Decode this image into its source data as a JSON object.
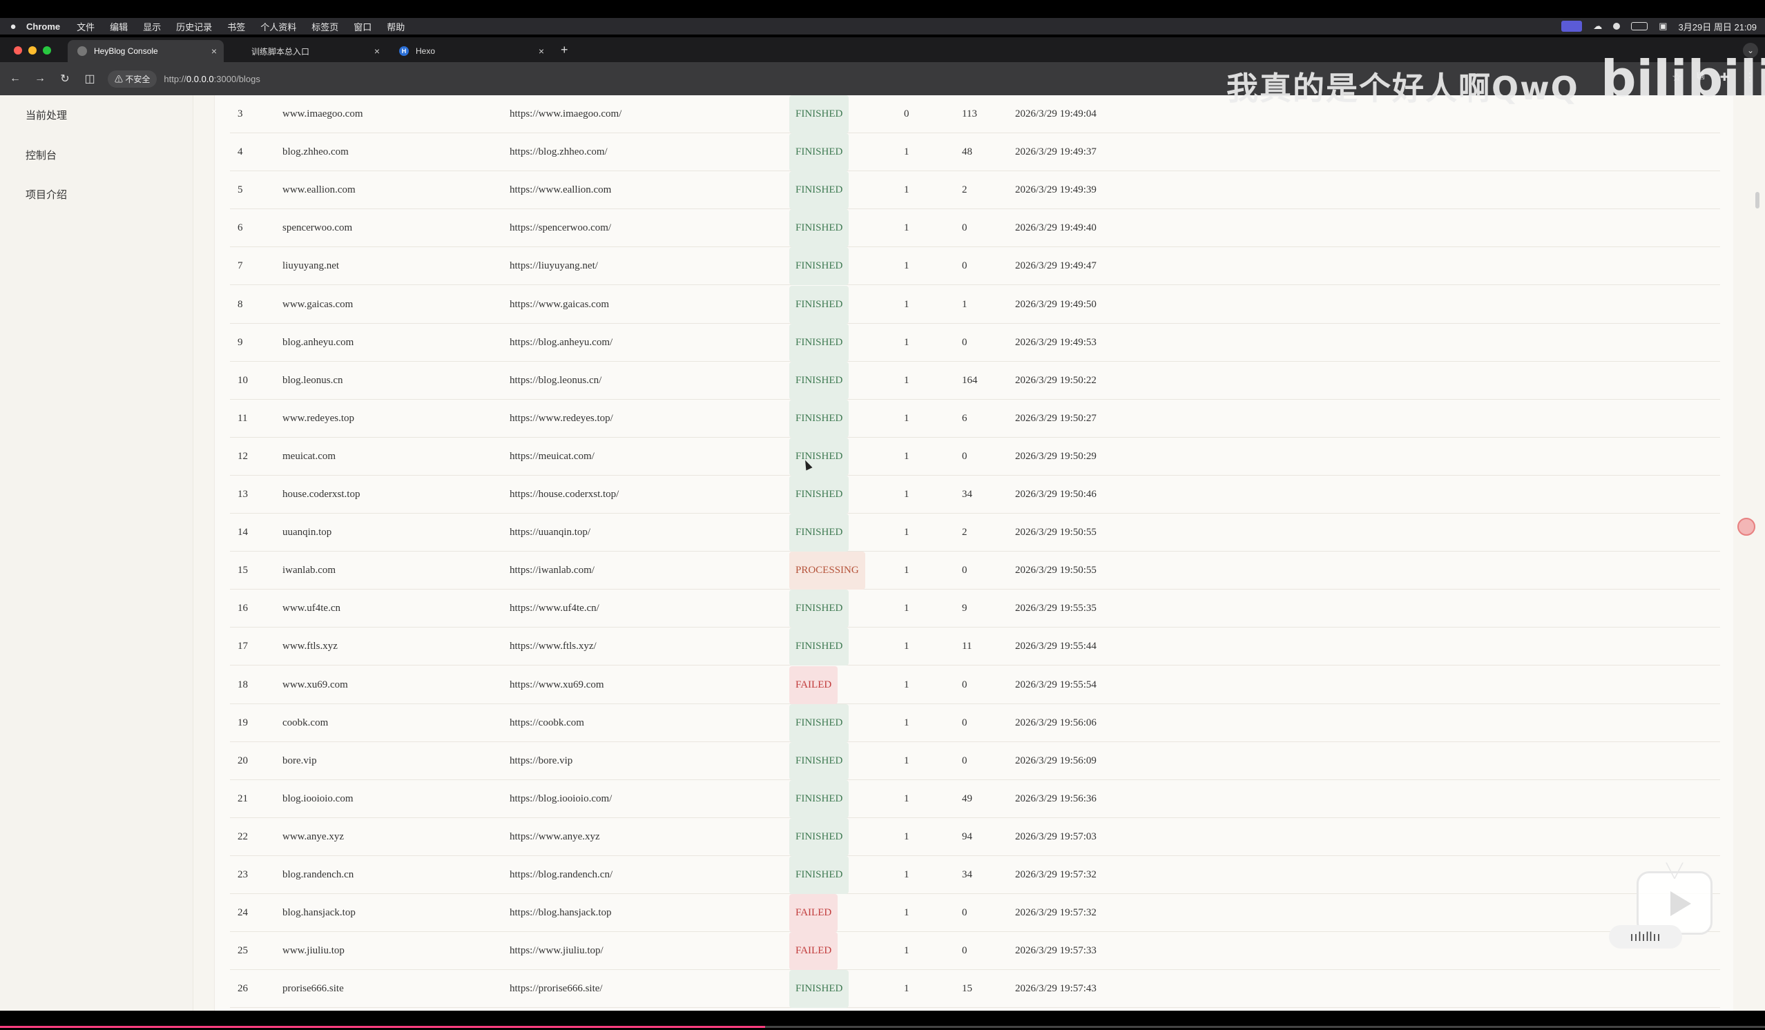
{
  "menubar": {
    "app": "Chrome",
    "items": [
      "文件",
      "编辑",
      "显示",
      "历史记录",
      "书签",
      "个人资料",
      "标签页",
      "窗口",
      "帮助"
    ],
    "datetime": "3月29日 周日 21:09"
  },
  "tabs": [
    {
      "title": "HeyBlog Console"
    },
    {
      "title": "训练脚本总入口"
    },
    {
      "title": "Hexo"
    }
  ],
  "toolbar": {
    "security": "不安全",
    "url_prefix": "http://",
    "url_host": "0.0.0.0",
    "url_rest": ":3000/blogs"
  },
  "sidebar": {
    "items": [
      {
        "label": "当前处理"
      },
      {
        "label": "控制台"
      },
      {
        "label": "项目介绍"
      }
    ]
  },
  "watermark": {
    "text": "我真的是个好人啊QwQ",
    "logo": "bilibili"
  },
  "rows": [
    {
      "id": "3",
      "name": "www.imaegoo.com",
      "url": "https://www.imaegoo.com/",
      "status": "FINISHED",
      "a": "0",
      "b": "113",
      "time": "2026/3/29 19:49:04"
    },
    {
      "id": "4",
      "name": "blog.zhheo.com",
      "url": "https://blog.zhheo.com/",
      "status": "FINISHED",
      "a": "1",
      "b": "48",
      "time": "2026/3/29 19:49:37"
    },
    {
      "id": "5",
      "name": "www.eallion.com",
      "url": "https://www.eallion.com",
      "status": "FINISHED",
      "a": "1",
      "b": "2",
      "time": "2026/3/29 19:49:39"
    },
    {
      "id": "6",
      "name": "spencerwoo.com",
      "url": "https://spencerwoo.com/",
      "status": "FINISHED",
      "a": "1",
      "b": "0",
      "time": "2026/3/29 19:49:40"
    },
    {
      "id": "7",
      "name": "liuyuyang.net",
      "url": "https://liuyuyang.net/",
      "status": "FINISHED",
      "a": "1",
      "b": "0",
      "time": "2026/3/29 19:49:47"
    },
    {
      "id": "8",
      "name": "www.gaicas.com",
      "url": "https://www.gaicas.com",
      "status": "FINISHED",
      "a": "1",
      "b": "1",
      "time": "2026/3/29 19:49:50"
    },
    {
      "id": "9",
      "name": "blog.anheyu.com",
      "url": "https://blog.anheyu.com/",
      "status": "FINISHED",
      "a": "1",
      "b": "0",
      "time": "2026/3/29 19:49:53"
    },
    {
      "id": "10",
      "name": "blog.leonus.cn",
      "url": "https://blog.leonus.cn/",
      "status": "FINISHED",
      "a": "1",
      "b": "164",
      "time": "2026/3/29 19:50:22"
    },
    {
      "id": "11",
      "name": "www.redeyes.top",
      "url": "https://www.redeyes.top/",
      "status": "FINISHED",
      "a": "1",
      "b": "6",
      "time": "2026/3/29 19:50:27"
    },
    {
      "id": "12",
      "name": "meuicat.com",
      "url": "https://meuicat.com/",
      "status": "FINISHED",
      "a": "1",
      "b": "0",
      "time": "2026/3/29 19:50:29"
    },
    {
      "id": "13",
      "name": "house.coderxst.top",
      "url": "https://house.coderxst.top/",
      "status": "FINISHED",
      "a": "1",
      "b": "34",
      "time": "2026/3/29 19:50:46"
    },
    {
      "id": "14",
      "name": "uuanqin.top",
      "url": "https://uuanqin.top/",
      "status": "FINISHED",
      "a": "1",
      "b": "2",
      "time": "2026/3/29 19:50:55"
    },
    {
      "id": "15",
      "name": "iwanlab.com",
      "url": "https://iwanlab.com/",
      "status": "PROCESSING",
      "a": "1",
      "b": "0",
      "time": "2026/3/29 19:50:55"
    },
    {
      "id": "16",
      "name": "www.uf4te.cn",
      "url": "https://www.uf4te.cn/",
      "status": "FINISHED",
      "a": "1",
      "b": "9",
      "time": "2026/3/29 19:55:35"
    },
    {
      "id": "17",
      "name": "www.ftls.xyz",
      "url": "https://www.ftls.xyz/",
      "status": "FINISHED",
      "a": "1",
      "b": "11",
      "time": "2026/3/29 19:55:44"
    },
    {
      "id": "18",
      "name": "www.xu69.com",
      "url": "https://www.xu69.com",
      "status": "FAILED",
      "a": "1",
      "b": "0",
      "time": "2026/3/29 19:55:54"
    },
    {
      "id": "19",
      "name": "coobk.com",
      "url": "https://coobk.com",
      "status": "FINISHED",
      "a": "1",
      "b": "0",
      "time": "2026/3/29 19:56:06"
    },
    {
      "id": "20",
      "name": "bore.vip",
      "url": "https://bore.vip",
      "status": "FINISHED",
      "a": "1",
      "b": "0",
      "time": "2026/3/29 19:56:09"
    },
    {
      "id": "21",
      "name": "blog.iooioio.com",
      "url": "https://blog.iooioio.com/",
      "status": "FINISHED",
      "a": "1",
      "b": "49",
      "time": "2026/3/29 19:56:36"
    },
    {
      "id": "22",
      "name": "www.anye.xyz",
      "url": "https://www.anye.xyz",
      "status": "FINISHED",
      "a": "1",
      "b": "94",
      "time": "2026/3/29 19:57:03"
    },
    {
      "id": "23",
      "name": "blog.randench.cn",
      "url": "https://blog.randench.cn/",
      "status": "FINISHED",
      "a": "1",
      "b": "34",
      "time": "2026/3/29 19:57:32"
    },
    {
      "id": "24",
      "name": "blog.hansjack.top",
      "url": "https://blog.hansjack.top",
      "status": "FAILED",
      "a": "1",
      "b": "0",
      "time": "2026/3/29 19:57:32"
    },
    {
      "id": "25",
      "name": "www.jiuliu.top",
      "url": "https://www.jiuliu.top/",
      "status": "FAILED",
      "a": "1",
      "b": "0",
      "time": "2026/3/29 19:57:33"
    },
    {
      "id": "26",
      "name": "prorise666.site",
      "url": "https://prorise666.site/",
      "status": "FINISHED",
      "a": "1",
      "b": "15",
      "time": "2026/3/29 19:57:43"
    }
  ]
}
